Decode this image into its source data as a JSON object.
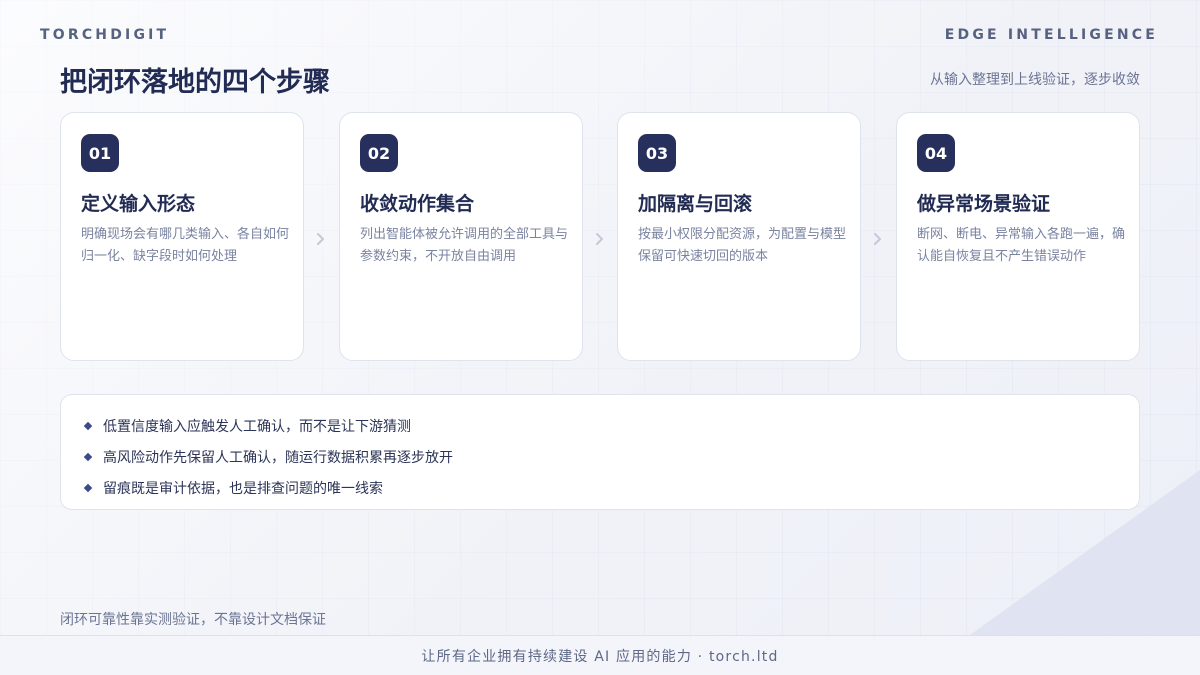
{
  "header": {
    "brand": "TORCHDIGIT",
    "brand_right": "EDGE INTELLIGENCE",
    "title": "把闭环落地的四个步骤",
    "subtitle": "从输入整理到上线验证，逐步收敛"
  },
  "steps": [
    {
      "num": "01",
      "title": "定义输入形态",
      "desc": "明确现场会有哪几类输入、各自如何归一化、缺字段时如何处理"
    },
    {
      "num": "02",
      "title": "收敛动作集合",
      "desc": "列出智能体被允许调用的全部工具与参数约束，不开放自由调用"
    },
    {
      "num": "03",
      "title": "加隔离与回滚",
      "desc": "按最小权限分配资源，为配置与模型保留可快速切回的版本"
    },
    {
      "num": "04",
      "title": "做异常场景验证",
      "desc": "断网、断电、异常输入各跑一遍，确认能自恢复且不产生错误动作"
    }
  ],
  "bullets": [
    "低置信度输入应触发人工确认，而不是让下游猜测",
    "高风险动作先保留人工确认，随运行数据积累再逐步放开",
    "留痕既是审计依据，也是排查问题的唯一线索"
  ],
  "foot_note": "闭环可靠性靠实测验证，不靠设计文档保证",
  "footer": {
    "text": "让所有企业拥有持续建设 AI 应用的能力 · torch.ltd"
  },
  "icons": {
    "step_separator": "chevron-right-icon",
    "bullet_marker": "diamond-icon"
  },
  "colors": {
    "accent": "#27305d",
    "title": "#222b53",
    "muted": "#7a83a0",
    "background": "#f1f3f8"
  }
}
